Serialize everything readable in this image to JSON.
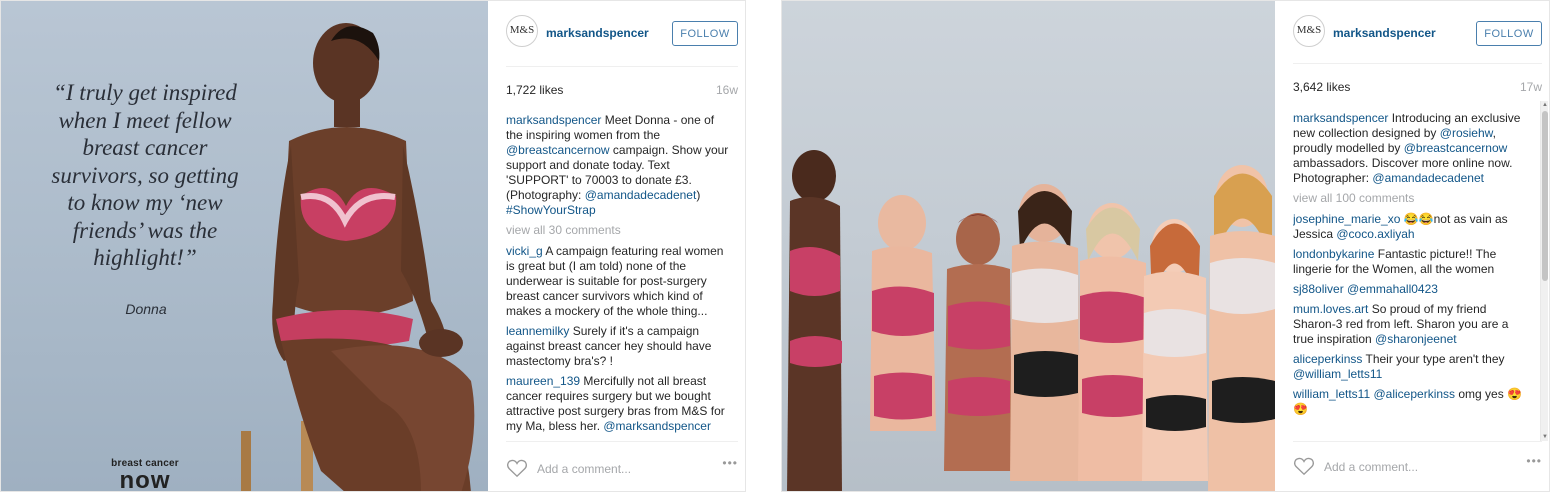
{
  "post1": {
    "quote": "“I truly get inspired when I meet fellow breast cancer survivors, so getting to know my ‘new friends’ was the highlight!”",
    "quote_name": "Donna",
    "logo_top": "breast cancer",
    "logo_main": "now",
    "avatar_text": "M&S",
    "username": "marksandspencer",
    "follow_label": "FOLLOW",
    "likes": "1,722 likes",
    "age": "16w",
    "caption": {
      "user": "marksandspencer",
      "t1": " Meet Donna - one of the inspiring women from the ",
      "l1": "@breastcancernow",
      "t2": " campaign. Show your support and donate today. Text 'SUPPORT' to 70003 to donate £3. (Photography: ",
      "l2": "@amandadecadenet",
      "t3": ") ",
      "l3": "#ShowYourStrap"
    },
    "view_all": "view all 30 comments",
    "comments": [
      {
        "user": "vicki_g",
        "text": " A campaign featuring real women is great but (I am told) none of the underwear is suitable for post-surgery breast cancer survivors which kind of makes a mockery of the whole thing..."
      },
      {
        "user": "leannemilky",
        "text": " Surely if it's a campaign against breast cancer hey should have mastectomy bra's? !"
      },
      {
        "user": "maureen_139",
        "text": " Mercifully not all breast cancer requires surgery but we bought attractive post surgery bras from M&S for my Ma, bless her. ",
        "link": "@marksandspencer"
      }
    ],
    "add_comment_placeholder": "Add a comment...",
    "more": "•••"
  },
  "post2": {
    "avatar_text": "M&S",
    "username": "marksandspencer",
    "follow_label": "FOLLOW",
    "likes": "3,642 likes",
    "age": "17w",
    "caption": {
      "user": "marksandspencer",
      "t1": " Introducing an exclusive new collection designed by ",
      "l1": "@rosiehw",
      "t2": ", proudly modelled by ",
      "l2": "@breastcancernow",
      "t3": " ambassadors. Discover more online now. Photographer: ",
      "l3": "@amandadecadenet"
    },
    "view_all": "view all 100 comments",
    "comments": [
      {
        "user": "josephine_marie_xo",
        "text": " 😂😂not as vain as Jessica ",
        "link": "@coco.axliyah"
      },
      {
        "user": "londonbykarine",
        "text": " Fantastic picture!! The lingerie for the Women, all the women"
      },
      {
        "user": "sj88oliver",
        "text": " ",
        "link": "@emmahall0423"
      },
      {
        "user": "mum.loves.art",
        "text": " So proud of my friend Sharon-3 red from left. Sharon you are a true inspiration ",
        "link": "@sharonjeenet"
      },
      {
        "user": "aliceperkinss",
        "text": " Their your type aren't they ",
        "link": "@william_letts11"
      },
      {
        "user": "william_letts11",
        "text": " ",
        "link": "@aliceperkinss",
        "tail": " omg yes 😍😍"
      }
    ],
    "add_comment_placeholder": "Add a comment...",
    "more": "•••"
  },
  "colors": {
    "link": "#125688",
    "muted": "#a5a7aa",
    "follow": "#4a7fad"
  }
}
